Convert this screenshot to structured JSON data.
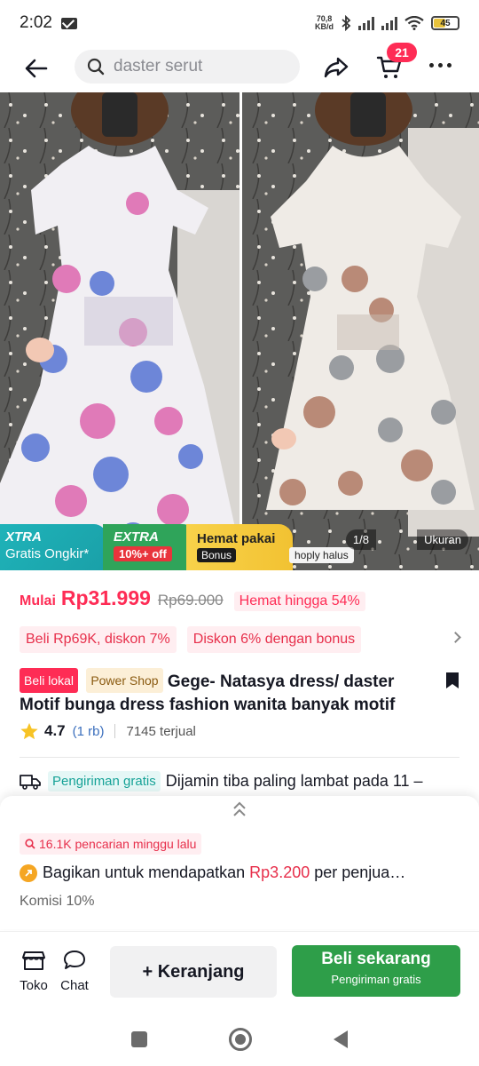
{
  "status_bar": {
    "time": "2:02",
    "net_speed_value": "70,8",
    "net_speed_unit": "KB/d",
    "battery": "45",
    "battery_level": 0.45
  },
  "header": {
    "search_placeholder": "daster serut",
    "cart_count": "21"
  },
  "gallery": {
    "page_indicator": "1/8",
    "size_label": "Ukuran",
    "banner": {
      "xtra_title": "XTRA",
      "xtra_sub": "Gratis Ongkir*",
      "extra_title": "EXTRA",
      "extra_sub": "10%+ off",
      "hemat_title": "Hemat pakai",
      "hemat_sub": "Bonus",
      "cut_text": "hoply halus"
    }
  },
  "price": {
    "prefix": "Mulai",
    "current": "Rp31.999",
    "original": "Rp69.000",
    "saving": "Hemat hingga 54%"
  },
  "promos": [
    "Beli Rp69K, diskon 7%",
    "Diskon 6% dengan bonus"
  ],
  "product": {
    "tag_local": "Beli lokal",
    "tag_shop": "Power Shop",
    "title": "Gege- Natasya dress/ daster Motif bunga dress fashion wanita banyak motif",
    "rating": "4.7",
    "rating_count": "(1 rb)",
    "sold": "7145 terjual"
  },
  "shipping": {
    "tag": "Pengiriman gratis",
    "text": "Dijamin tiba paling lambat pada 11 –"
  },
  "sheet": {
    "trend": "16.1K pencarian minggu lalu",
    "earn_prefix": "Bagikan untuk mendapatkan",
    "earn_amount": "Rp3.200",
    "earn_suffix": "per penjua…",
    "commission": "Komisi 10%"
  },
  "actions": {
    "shop": "Toko",
    "chat": "Chat",
    "add_cart": "+ Keranjang",
    "buy": "Beli sekarang",
    "buy_sub": "Pengiriman gratis"
  },
  "colors": {
    "accent": "#fe2c55",
    "buy_green": "#2e9e49",
    "teal": "#16a297"
  }
}
